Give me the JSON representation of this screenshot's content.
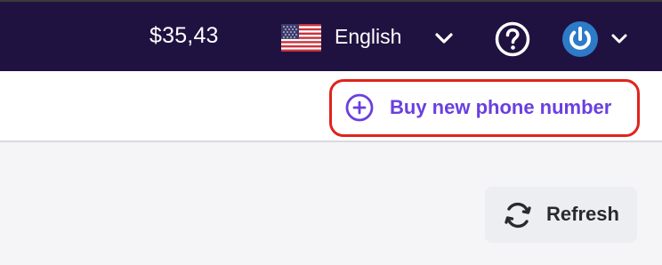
{
  "header": {
    "balance": "$35,43",
    "language": {
      "label": "English",
      "flag_icon": "us-flag-icon",
      "chevron_icon": "chevron-down-icon"
    },
    "help_icon": "question-circle-icon",
    "avatar_icon": "power-avatar-icon",
    "user_menu_icon": "chevron-down-icon",
    "colors": {
      "background": "#1f1240",
      "text": "#ffffff",
      "avatar": "#2d7ac8"
    }
  },
  "toolbar": {
    "buy_label": "Buy new phone number",
    "buy_icon": "plus-circle-icon",
    "accent": "#6a3fe0",
    "highlight_color": "#e0241a"
  },
  "content": {
    "refresh_label": "Refresh",
    "refresh_icon": "refresh-icon"
  }
}
